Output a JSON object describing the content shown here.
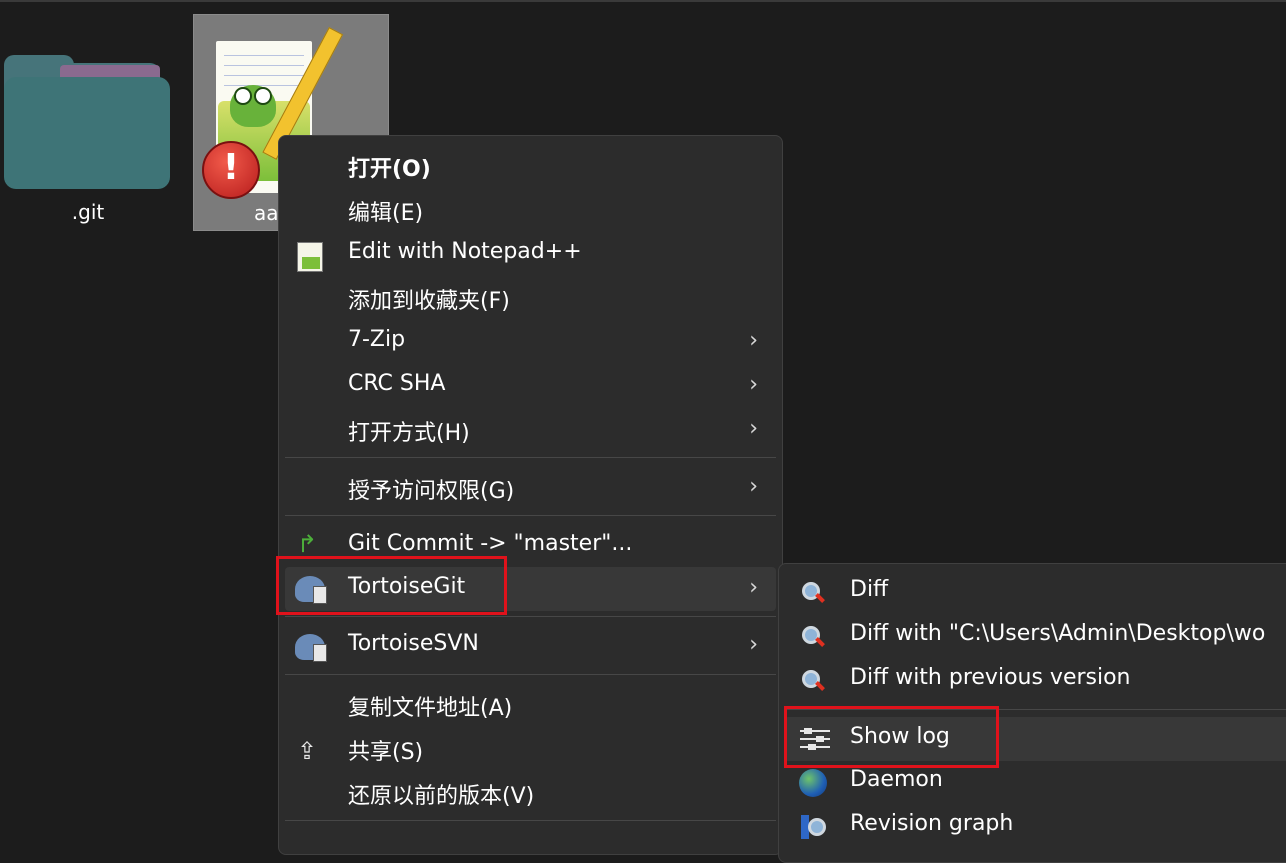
{
  "desktop": {
    "folder_label": ".git",
    "file_label": "aa"
  },
  "context_menu": {
    "items": [
      {
        "label": "打开(O)",
        "bold": true,
        "submenu": false
      },
      {
        "label": "编辑(E)",
        "submenu": false
      },
      {
        "label": "Edit with Notepad++",
        "icon": "notepadpp-icon",
        "submenu": false
      },
      {
        "label": "添加到收藏夹(F)",
        "submenu": false
      },
      {
        "label": "7-Zip",
        "submenu": true
      },
      {
        "label": "CRC SHA",
        "submenu": true
      },
      {
        "label": "打开方式(H)",
        "submenu": true
      },
      {
        "label": "授予访问权限(G)",
        "submenu": true
      },
      {
        "label": "Git Commit -> \"master\"...",
        "icon": "git-commit-icon",
        "submenu": false
      },
      {
        "label": "TortoiseGit",
        "icon": "tortoisegit-icon",
        "submenu": true,
        "highlighted": true
      },
      {
        "label": "TortoiseSVN",
        "icon": "tortoisesvn-icon",
        "submenu": true
      },
      {
        "label": "复制文件地址(A)",
        "submenu": false
      },
      {
        "label": "共享(S)",
        "icon": "share-icon",
        "submenu": false
      },
      {
        "label": "还原以前的版本(V)",
        "submenu": false
      }
    ],
    "arrow": "›"
  },
  "tortoisegit_submenu": {
    "items": [
      {
        "label": "Diff",
        "icon": "diff-icon"
      },
      {
        "label": "Diff with \"C:\\Users\\Admin\\Desktop\\wo",
        "icon": "diff-icon"
      },
      {
        "label": "Diff with previous version",
        "icon": "diff-icon"
      },
      {
        "label": "Show log",
        "icon": "log-icon",
        "highlighted": true
      },
      {
        "label": "Daemon",
        "icon": "globe-icon"
      },
      {
        "label": "Revision graph",
        "icon": "revision-graph-icon"
      }
    ]
  },
  "colors": {
    "background": "#1c1c1c",
    "menu_bg": "#2c2c2c",
    "highlight": "#383838",
    "annotation_red": "#e0121b"
  },
  "badges": {
    "error_glyph": "!"
  }
}
